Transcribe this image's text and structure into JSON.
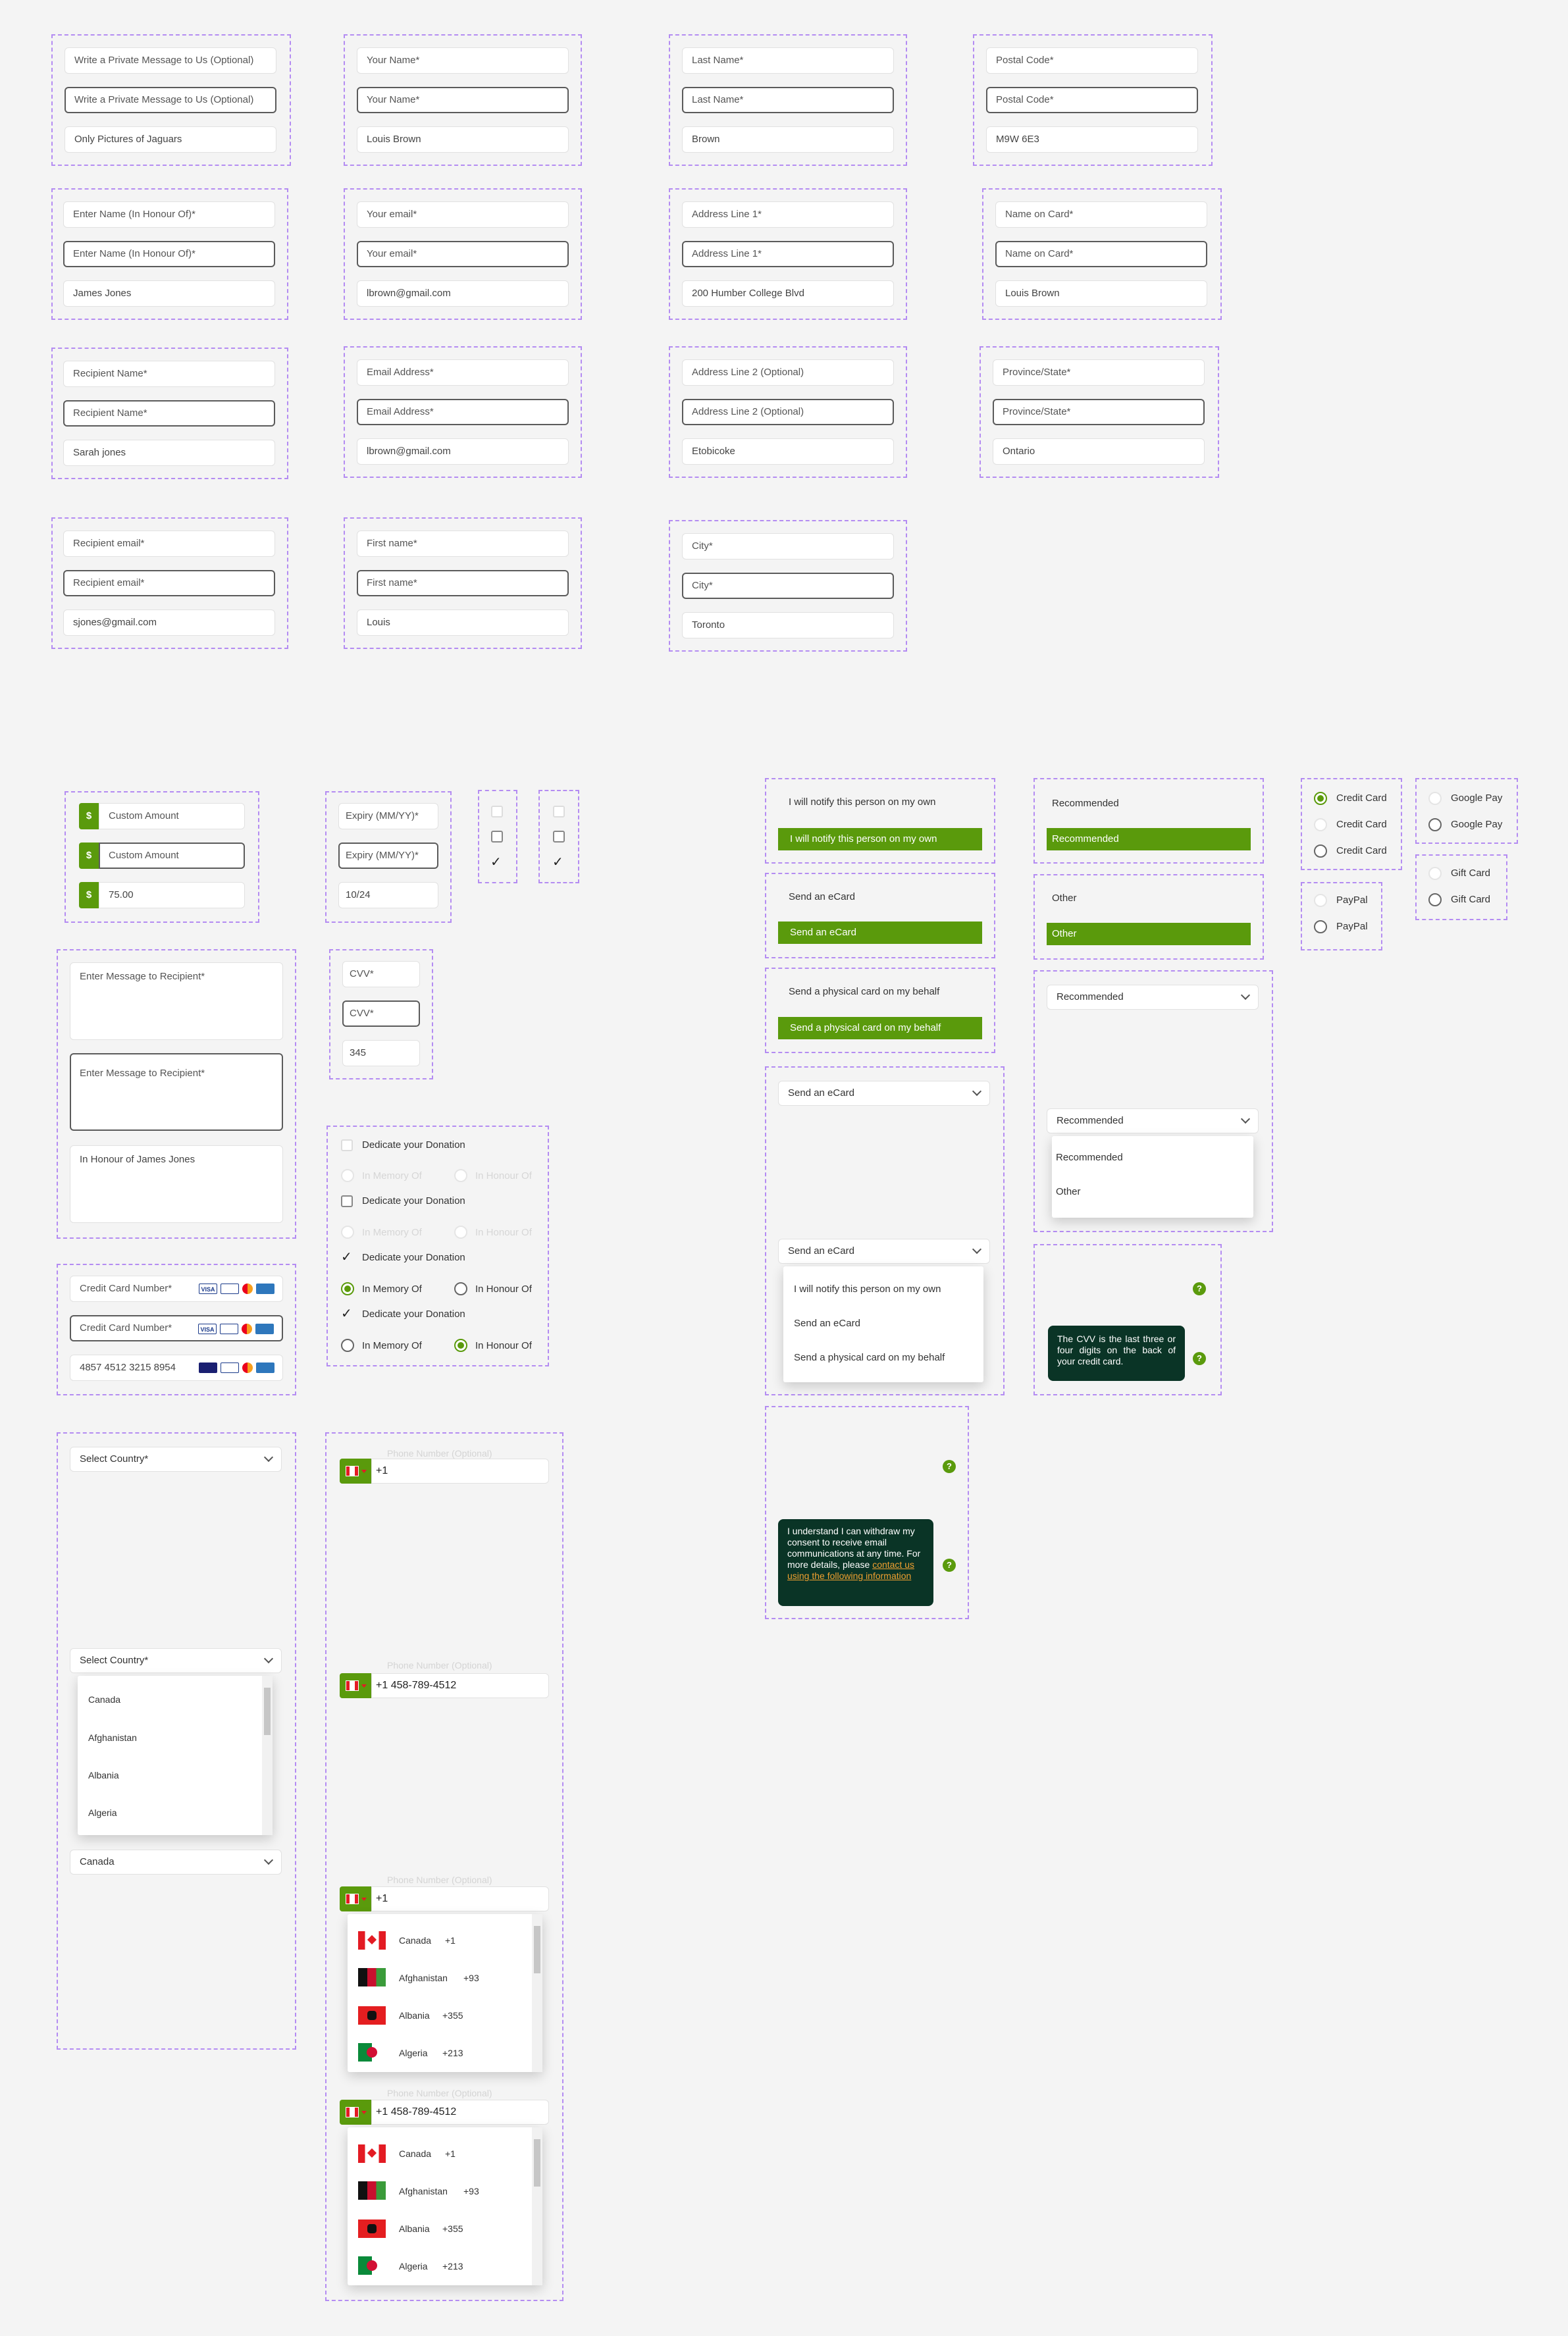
{
  "text_fields": {
    "private_message": {
      "placeholder": "Write a Private Message to Us (Optional)",
      "value": "Only Pictures of Jaguars"
    },
    "honour_name": {
      "placeholder": "Enter Name (In Honour Of)*",
      "value": "James Jones"
    },
    "recipient_name": {
      "placeholder": "Recipient Name*",
      "value": "Sarah jones"
    },
    "recipient_email": {
      "placeholder": "Recipient email*",
      "value": "sjones@gmail.com"
    },
    "your_name": {
      "placeholder": "Your Name*",
      "value": "Louis Brown"
    },
    "your_email": {
      "placeholder": "Your email*",
      "value": "lbrown@gmail.com"
    },
    "email_address": {
      "placeholder": "Email Address*",
      "value": "lbrown@gmail.com"
    },
    "first_name": {
      "placeholder": "First name*",
      "value": "Louis"
    },
    "last_name": {
      "placeholder": "Last Name*",
      "value": "Brown"
    },
    "address1": {
      "placeholder": "Address Line 1*",
      "value": "200 Humber College Blvd"
    },
    "address2": {
      "placeholder": "Address Line 2 (Optional)",
      "value": "Etobicoke"
    },
    "city": {
      "placeholder": "City*",
      "value": "Toronto"
    },
    "postal_code": {
      "placeholder": "Postal Code*",
      "value": "M9W 6E3"
    },
    "name_on_card": {
      "placeholder": "Name on Card*",
      "value": "Louis Brown"
    },
    "province": {
      "placeholder": "Province/State*",
      "value": "Ontario"
    }
  },
  "amount": {
    "currency_symbol": "$",
    "placeholder": "Custom Amount",
    "value": "75.00"
  },
  "expiry": {
    "placeholder": "Expiry (MM/YY)*",
    "value": "10/24"
  },
  "cvv": {
    "placeholder": "CVV*",
    "value": "345"
  },
  "message": {
    "placeholder": "Enter Message to Recipient*",
    "value": "In Honour of James Jones"
  },
  "credit_card": {
    "placeholder": "Credit Card Number*",
    "value": "4857 4512 3215 8954",
    "brand_visa": "VISA"
  },
  "dedicate": {
    "label": "Dedicate your Donation",
    "memory": "In Memory Of",
    "honour": "In Honour Of"
  },
  "notify_options": {
    "notify_own": "I will notify this person on my own",
    "ecard": "Send an eCard",
    "physical": "Send a physical card on my behalf"
  },
  "recommended": {
    "recommended": "Recommended",
    "other": "Other"
  },
  "ecard_dropdown": {
    "selected": "Send an eCard",
    "options": [
      "I will notify this person on my own",
      "Send an eCard",
      "Send a physical card on my behalf"
    ]
  },
  "recommended_dropdown": {
    "selected": "Recommended",
    "options": [
      "Recommended",
      "Other"
    ]
  },
  "payment": {
    "credit_card": "Credit Card",
    "google_pay": "Google Pay",
    "paypal": "PayPal",
    "gift_card": "Gift Card"
  },
  "tooltips": {
    "help_glyph": "?",
    "cvv": "The CVV is the last three or four digits on the back of your credit card.",
    "consent_text": "I understand I can withdraw my consent to receive email communications at any time. For more details, please ",
    "consent_link": "contact us using the following information"
  },
  "country": {
    "placeholder": "Select Country*",
    "options": [
      "Canada",
      "Afghanistan",
      "Albania",
      "Algeria"
    ],
    "selected": "Canada"
  },
  "phone": {
    "label": "Phone Number (Optional)",
    "prefix": "+1",
    "value": "+1 458-789-4512",
    "countries": [
      {
        "name": "Canada",
        "code": "+1",
        "flag": "canada-flag-icon"
      },
      {
        "name": "Afghanistan",
        "code": "+93",
        "flag": "afghanistan-flag-icon"
      },
      {
        "name": "Albania",
        "code": "+355",
        "flag": "albania-flag-icon"
      },
      {
        "name": "Algeria",
        "code": "+213",
        "flag": "algeria-flag-icon"
      }
    ]
  },
  "colors": {
    "accent": "#5a9a0c",
    "tooltip_bg": "#0a3426",
    "dashed_border": "#b48cf2",
    "link": "#f0a030"
  }
}
